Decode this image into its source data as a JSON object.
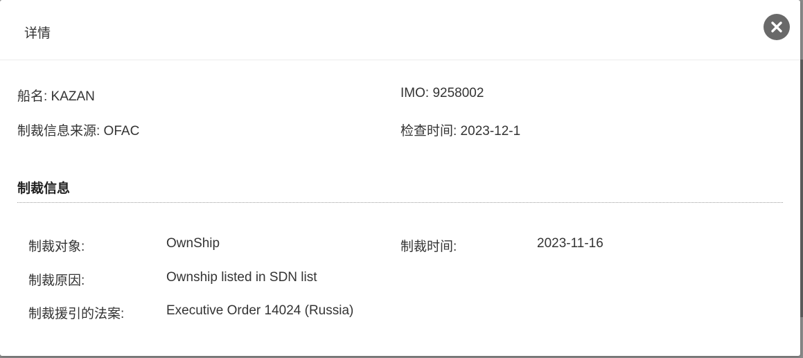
{
  "dialog": {
    "title": "详情",
    "close_icon": "close-icon"
  },
  "info": {
    "ship_name": "船名: KAZAN",
    "imo": "IMO: 9258002",
    "source": "制裁信息来源: OFAC",
    "check_time": "检查时间: 2023-12-1"
  },
  "sanctions": {
    "section_title": "制裁信息",
    "target_label": "制裁对象:",
    "target_value": "OwnShip",
    "time_label": "制裁时间:",
    "time_value": "2023-11-16",
    "reason_label": "制裁原因:",
    "reason_value": "Ownship listed in SDN list",
    "law_label": "制裁援引的法案:",
    "law_value": "Executive Order 14024 (Russia)"
  }
}
